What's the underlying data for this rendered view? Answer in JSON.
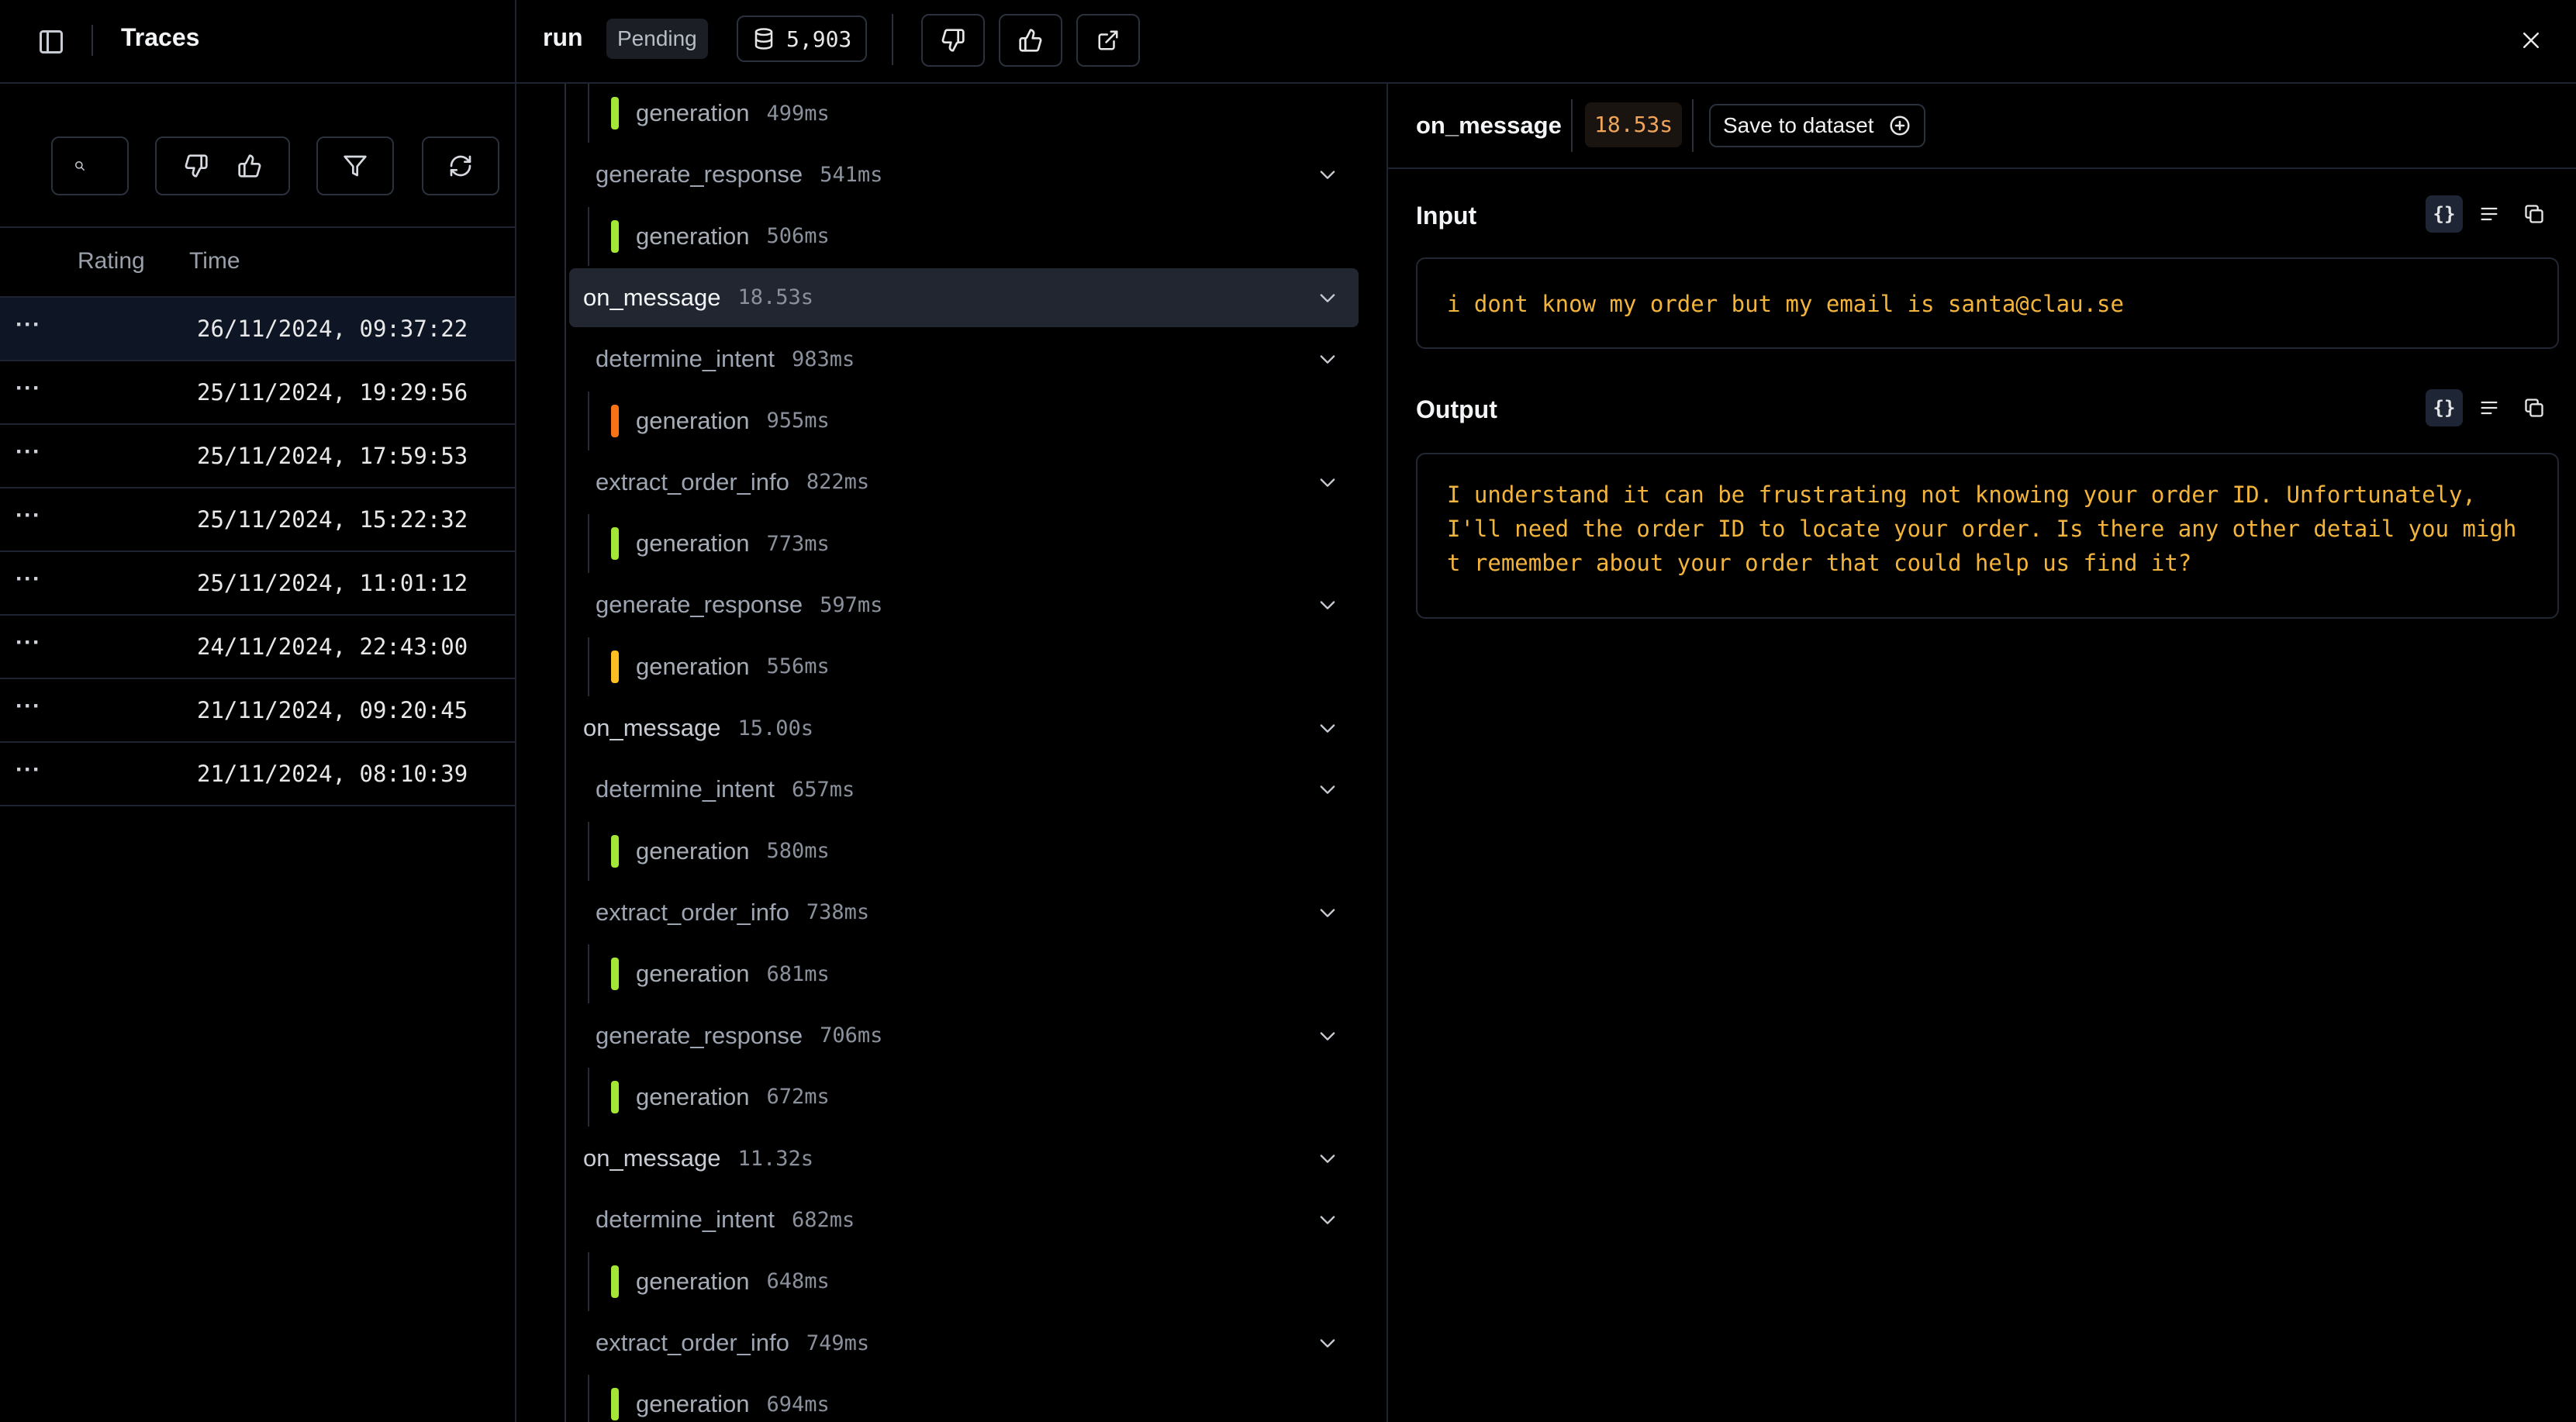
{
  "sidebar": {
    "title": "Traces",
    "search_placeholder": "",
    "columns": {
      "rating": "Rating",
      "time": "Time"
    },
    "rows": [
      {
        "actions": "···",
        "time": "26/11/2024, 09:37:22",
        "selected": true
      },
      {
        "actions": "···",
        "time": "25/11/2024, 19:29:56"
      },
      {
        "actions": "···",
        "time": "25/11/2024, 17:59:53"
      },
      {
        "actions": "···",
        "time": "25/11/2024, 15:22:32"
      },
      {
        "actions": "···",
        "time": "25/11/2024, 11:01:12"
      },
      {
        "actions": "···",
        "time": "24/11/2024, 22:43:00"
      },
      {
        "actions": "···",
        "time": "21/11/2024, 09:20:45"
      },
      {
        "actions": "···",
        "time": "21/11/2024, 08:10:39"
      }
    ]
  },
  "topbar": {
    "title": "run",
    "status": "Pending",
    "count": "5,903"
  },
  "colors": {
    "bar_green": "#a3e635",
    "bar_orange": "#f97316",
    "bar_amber": "#fbbf24",
    "text_amber": "#f3b43c",
    "duration_badge": "#f0a45a"
  },
  "tree": [
    {
      "level": 2,
      "name": "generation",
      "duration": "499ms",
      "bar": "#a3e635"
    },
    {
      "level": 1,
      "name": "generate_response",
      "duration": "541ms"
    },
    {
      "level": 2,
      "name": "generation",
      "duration": "506ms",
      "bar": "#a3e635"
    },
    {
      "level": 0,
      "name": "on_message",
      "duration": "18.53s",
      "selected": true
    },
    {
      "level": 1,
      "name": "determine_intent",
      "duration": "983ms"
    },
    {
      "level": 2,
      "name": "generation",
      "duration": "955ms",
      "bar": "#f97316"
    },
    {
      "level": 1,
      "name": "extract_order_info",
      "duration": "822ms"
    },
    {
      "level": 2,
      "name": "generation",
      "duration": "773ms",
      "bar": "#a3e635"
    },
    {
      "level": 1,
      "name": "generate_response",
      "duration": "597ms"
    },
    {
      "level": 2,
      "name": "generation",
      "duration": "556ms",
      "bar": "#fbbf24"
    },
    {
      "level": 0,
      "name": "on_message",
      "duration": "15.00s"
    },
    {
      "level": 1,
      "name": "determine_intent",
      "duration": "657ms"
    },
    {
      "level": 2,
      "name": "generation",
      "duration": "580ms",
      "bar": "#a3e635"
    },
    {
      "level": 1,
      "name": "extract_order_info",
      "duration": "738ms"
    },
    {
      "level": 2,
      "name": "generation",
      "duration": "681ms",
      "bar": "#a3e635"
    },
    {
      "level": 1,
      "name": "generate_response",
      "duration": "706ms"
    },
    {
      "level": 2,
      "name": "generation",
      "duration": "672ms",
      "bar": "#a3e635"
    },
    {
      "level": 0,
      "name": "on_message",
      "duration": "11.32s"
    },
    {
      "level": 1,
      "name": "determine_intent",
      "duration": "682ms"
    },
    {
      "level": 2,
      "name": "generation",
      "duration": "648ms",
      "bar": "#a3e635"
    },
    {
      "level": 1,
      "name": "extract_order_info",
      "duration": "749ms"
    },
    {
      "level": 2,
      "name": "generation",
      "duration": "694ms",
      "bar": "#a3e635"
    }
  ],
  "details": {
    "name": "on_message",
    "duration": "18.53s",
    "save_label": "Save to dataset",
    "input_title": "Input",
    "input_text": "i dont know my order but my email is santa@clau.se",
    "output_title": "Output",
    "output_text": "I understand it can be frustrating not knowing your order ID. Unfortunately, I'll need the order ID to locate your order. Is there any other detail you might remember about your order that could help us find it?"
  },
  "icons": {
    "sidebar_toggle": "sidebar-toggle-icon",
    "search": "search-icon",
    "thumbs_down": "thumbs-down-icon",
    "thumbs_up": "thumbs-up-icon",
    "filter": "filter-icon",
    "refresh": "refresh-icon",
    "database": "database-icon",
    "external_link": "external-link-icon",
    "close": "close-icon",
    "chevron": "chevron-down-icon",
    "plus_circle": "plus-circle-icon",
    "json_view": "json-braces-icon",
    "text_view": "text-lines-icon",
    "copy": "copy-icon"
  }
}
